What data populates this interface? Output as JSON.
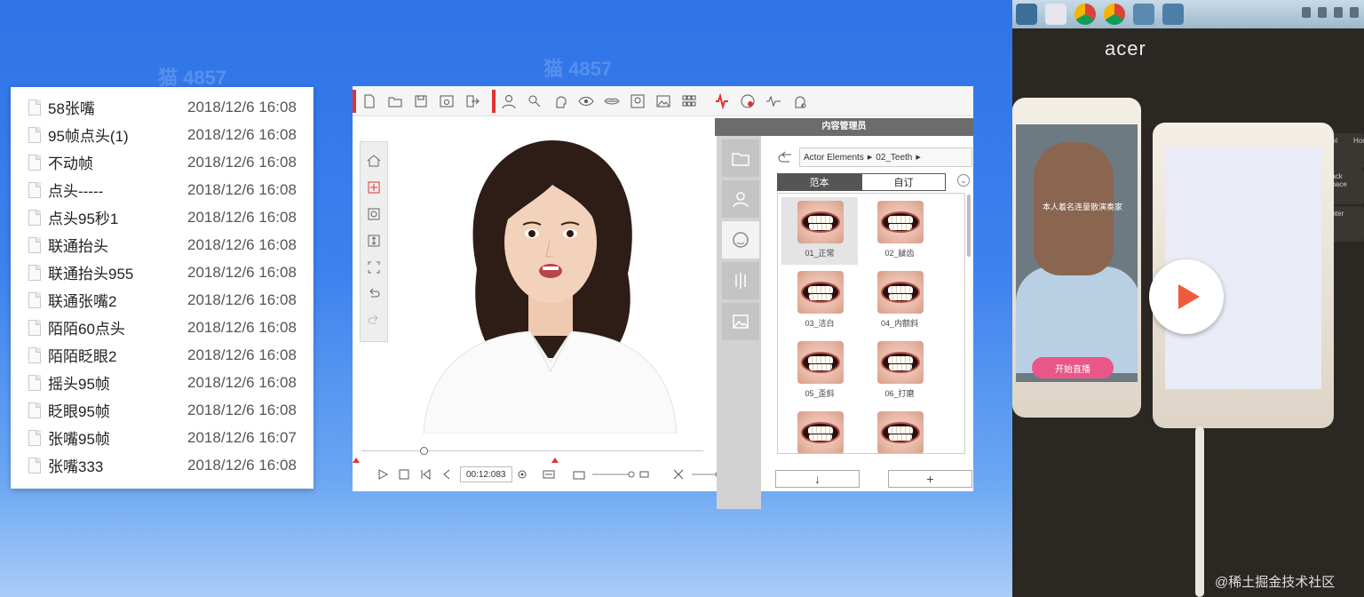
{
  "watermark": {
    "text": "猫 4857"
  },
  "file_list": [
    {
      "name": "58张嘴",
      "date": "2018/12/6 16:08"
    },
    {
      "name": "95帧点头(1)",
      "date": "2018/12/6 16:08"
    },
    {
      "name": "不动帧",
      "date": "2018/12/6 16:08"
    },
    {
      "name": "点头-----",
      "date": "2018/12/6 16:08"
    },
    {
      "name": "点头95秒1",
      "date": "2018/12/6 16:08"
    },
    {
      "name": "联通抬头",
      "date": "2018/12/6 16:08"
    },
    {
      "name": "联通抬头955",
      "date": "2018/12/6 16:08"
    },
    {
      "name": "联通张嘴2",
      "date": "2018/12/6 16:08"
    },
    {
      "name": "陌陌60点头",
      "date": "2018/12/6 16:08"
    },
    {
      "name": "陌陌眨眼2",
      "date": "2018/12/6 16:08"
    },
    {
      "name": "摇头95帧",
      "date": "2018/12/6 16:08"
    },
    {
      "name": "眨眼95帧",
      "date": "2018/12/6 16:08"
    },
    {
      "name": "张嘴95帧",
      "date": "2018/12/6 16:07"
    },
    {
      "name": "张嘴333",
      "date": "2018/12/6 16:08"
    }
  ],
  "editor": {
    "timecode": "00:12:083",
    "content_manager": {
      "title": "内容管理员",
      "breadcrumb": [
        "Actor Elements",
        "02_Teeth"
      ],
      "tabs": {
        "template": "范本",
        "custom": "自订"
      },
      "items": [
        "01_正常",
        "02_龇齿",
        "03_洁白",
        "04_内额斜",
        "05_歪斜",
        "06_打磨",
        "",
        ""
      ]
    },
    "accent_color": "#e0342f"
  },
  "photo": {
    "brand": "acer",
    "phone_button": "开始直播",
    "phone_caption": "本人着名连量散演奏家",
    "keys": [
      "Del",
      "Home",
      "Back Space",
      "Enter"
    ],
    "credit": "@稀土掘金技术社区"
  }
}
